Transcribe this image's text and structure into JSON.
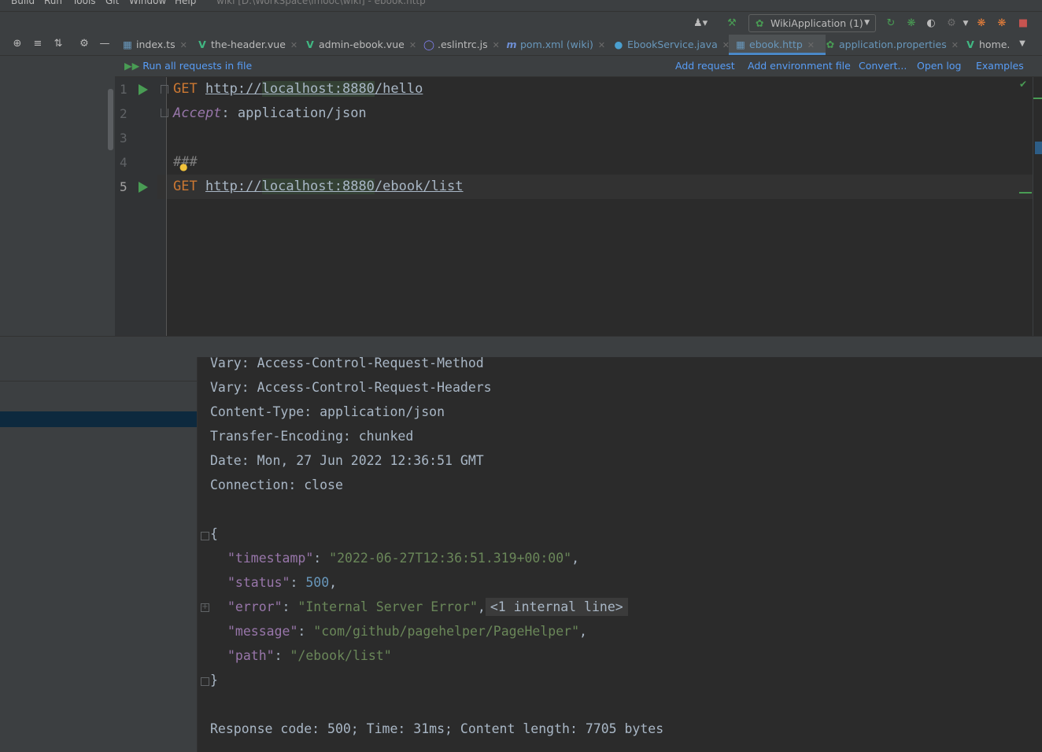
{
  "menu": {
    "items": [
      "Build",
      "Run",
      "Tools",
      "Git",
      "Window",
      "Help"
    ],
    "window_title": "wiki [D:\\WorkSpace\\imooc\\wiki] - ebook.http"
  },
  "toolbar": {
    "run_config": "WikiApplication (1)"
  },
  "tabs": [
    {
      "label": "index.ts",
      "icon": "ts-file-icon"
    },
    {
      "label": "the-header.vue",
      "icon": "vue-file-icon"
    },
    {
      "label": "admin-ebook.vue",
      "icon": "vue-file-icon"
    },
    {
      "label": ".eslintrc.js",
      "icon": "config-file-icon"
    },
    {
      "label": "pom.xml (wiki)",
      "icon": "maven-file-icon"
    },
    {
      "label": "EbookService.java",
      "icon": "java-class-icon"
    },
    {
      "label": "ebook.http",
      "icon": "http-file-icon"
    },
    {
      "label": "application.properties",
      "icon": "properties-file-icon"
    },
    {
      "label": "home.",
      "icon": "vue-file-icon"
    }
  ],
  "editor_toolbar": {
    "run_all": "Run all requests in file",
    "links": [
      "Add request",
      "Add environment file",
      "Convert...",
      "Open log",
      "Examples"
    ]
  },
  "editor": {
    "line_numbers": [
      "1",
      "2",
      "3",
      "4",
      "5"
    ],
    "line1": {
      "method": "GET",
      "scheme": "http://",
      "host": "localhost:8880",
      "path": "/hello"
    },
    "line2": {
      "header_name": "Accept",
      "colon": ": ",
      "header_value": "application/json"
    },
    "line4": {
      "separator": "###"
    },
    "line5": {
      "method": "GET",
      "scheme": "http://",
      "host": "localhost:8880",
      "path": "/ebook/list"
    }
  },
  "response": {
    "headers": [
      "Vary: Access-Control-Request-Method",
      "Vary: Access-Control-Request-Headers",
      "Content-Type: application/json",
      "Transfer-Encoding: chunked",
      "Date: Mon, 27 Jun 2022 12:36:51 GMT",
      "Connection: close"
    ],
    "open_brace": "{",
    "close_brace": "}",
    "json": {
      "timestamp_key": "\"timestamp\"",
      "timestamp_val": "\"2022-06-27T12:36:51.319+00:00\"",
      "status_key": "\"status\"",
      "status_val": "500",
      "error_key": "\"error\"",
      "error_val": "\"Internal Server Error\"",
      "error_folded": "<1 internal line>",
      "message_key": "\"message\"",
      "message_val": "\"com/github/pagehelper/PageHelper\"",
      "path_key": "\"path\"",
      "path_val": "\"/ebook/list\""
    },
    "summary": "Response code: 500; Time: 31ms; Content length: 7705 bytes"
  }
}
